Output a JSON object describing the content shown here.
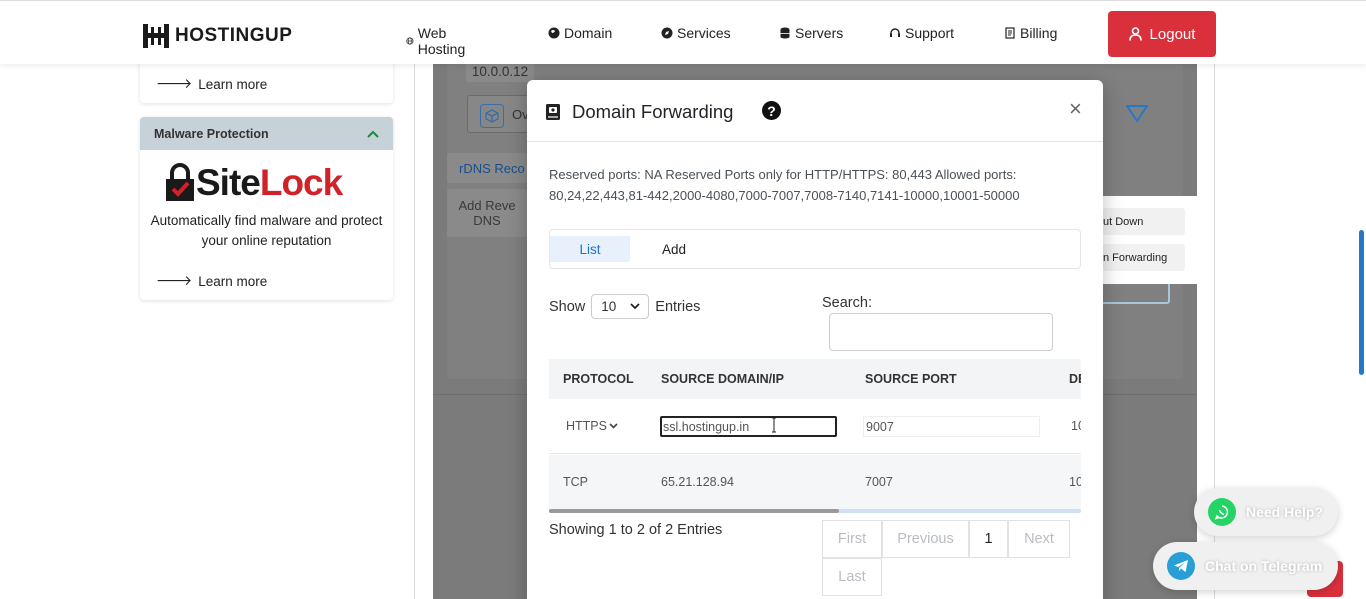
{
  "header": {
    "logo_text": "HOSTINGUP",
    "nav": [
      "Web Hosting",
      "Domain",
      "Services",
      "Servers",
      "Support",
      "Billing"
    ],
    "logout_label": "Logout",
    "accent": "#d9303c"
  },
  "sidebar": {
    "learn_more_1": "Learn more",
    "malware_title": "Malware Protection",
    "sitelock_site": "Site",
    "sitelock_lock": "Lock",
    "sitelock_desc": "Automatically find malware and protect your online reputation",
    "learn_more_2": "Learn more"
  },
  "background": {
    "ip": "10.0.0.12",
    "overview_label": "Ov",
    "rdns_label": "rDNS Reco",
    "add_reverse_label": "Add Reve\nDNS",
    "shutdown_label": "ut Down",
    "forwarding_label": "n Forwarding"
  },
  "modal": {
    "title": "Domain Forwarding",
    "close": "×",
    "ports_text": "Reserved ports: NA    Reserved Ports only for HTTP/HTTPS: 80,443    Allowed ports: 80,24,22,443,81-442,2000-4080,7000-7007,7008-7140,7141-10000,10001-50000",
    "tabs": {
      "list": "List",
      "add": "Add"
    },
    "show_label": "Show",
    "entries_value": "10",
    "entries_label": "Entries",
    "search_label": "Search:",
    "search_value": "",
    "columns": [
      "PROTOCOL",
      "SOURCE DOMAIN/IP",
      "SOURCE PORT",
      "DE"
    ],
    "rows": [
      {
        "protocol": "HTTPS",
        "source": "ssl.hostingup.in",
        "port": "9007",
        "dest": "10"
      },
      {
        "protocol": "TCP",
        "source": "65.21.128.94",
        "port": "7007",
        "dest": "10"
      }
    ],
    "showing": "Showing 1 to 2 of 2 Entries",
    "pager": {
      "first": "First",
      "previous": "Previous",
      "page": "1",
      "next": "Next",
      "last": "Last"
    }
  },
  "chat": {
    "help": "Need Help?",
    "telegram": "Chat on Telegram"
  }
}
